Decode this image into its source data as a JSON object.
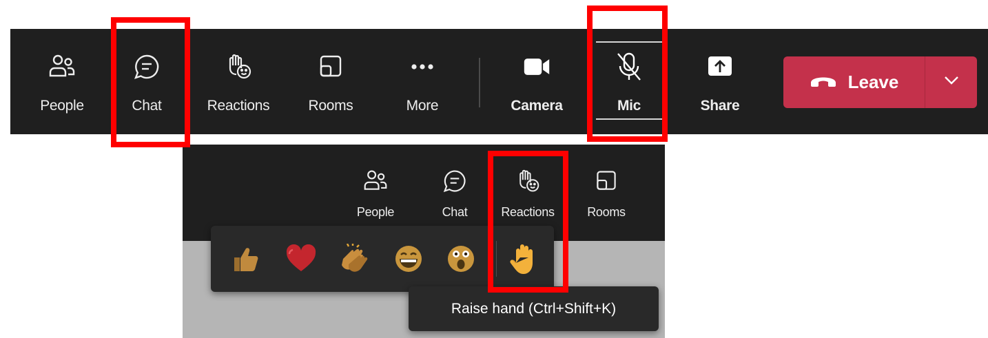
{
  "toolbar": {
    "items": [
      {
        "label": "People",
        "icon": "people-icon"
      },
      {
        "label": "Chat",
        "icon": "chat-icon"
      },
      {
        "label": "Reactions",
        "icon": "reactions-icon"
      },
      {
        "label": "Rooms",
        "icon": "rooms-icon"
      },
      {
        "label": "More",
        "icon": "more-icon"
      },
      {
        "label": "Camera",
        "icon": "camera-icon"
      },
      {
        "label": "Mic",
        "icon": "mic-off-icon"
      },
      {
        "label": "Share",
        "icon": "share-icon"
      }
    ],
    "leave": {
      "label": "Leave",
      "icon": "phone-hangup-icon",
      "menu_icon": "chevron-down-icon"
    }
  },
  "zoomed": {
    "items": [
      {
        "label": "People",
        "icon": "people-icon"
      },
      {
        "label": "Chat",
        "icon": "chat-icon"
      },
      {
        "label": "Reactions",
        "icon": "reactions-icon"
      },
      {
        "label": "Rooms",
        "icon": "rooms-icon"
      }
    ],
    "reactions": [
      {
        "name": "like",
        "icon": "thumbs-up-emoji"
      },
      {
        "name": "love",
        "icon": "heart-emoji"
      },
      {
        "name": "applause",
        "icon": "clapping-hands-emoji"
      },
      {
        "name": "laugh",
        "icon": "laughing-face-emoji"
      },
      {
        "name": "surprised",
        "icon": "surprised-face-emoji"
      },
      {
        "name": "raise-hand",
        "icon": "raised-hand-emoji"
      }
    ],
    "tooltip": "Raise hand (Ctrl+Shift+K)"
  },
  "colors": {
    "toolbar_bg": "#1f1f1f",
    "leave_red": "#c4314b",
    "highlight": "#ff0000",
    "canvas_gray": "#b5b5b5"
  }
}
